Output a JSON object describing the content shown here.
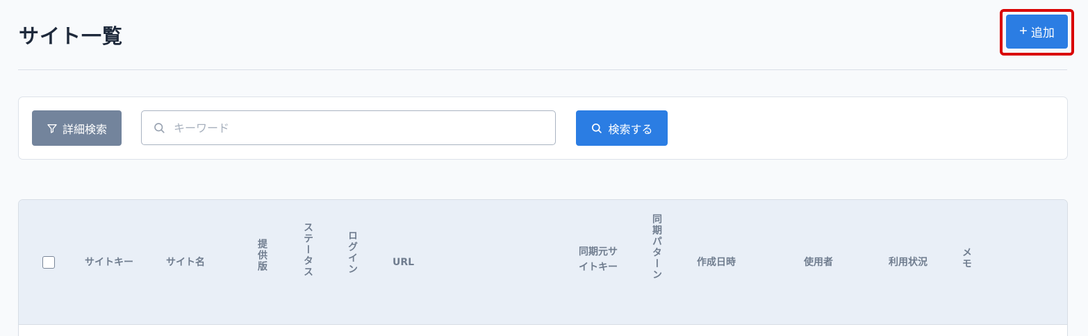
{
  "header": {
    "title": "サイト一覧",
    "add_button_label": "追加",
    "add_button_icon": "plus-icon"
  },
  "search": {
    "detail_button_label": "詳細検索",
    "detail_button_icon": "filter-icon",
    "placeholder": "キーワード",
    "value": "",
    "search_button_label": "検索する",
    "search_button_icon": "search-icon"
  },
  "table": {
    "columns": [
      {
        "key": "site_key",
        "label": "サイトキー"
      },
      {
        "key": "site_name",
        "label": "サイト名"
      },
      {
        "key": "provided_version",
        "label": "提供版"
      },
      {
        "key": "status",
        "label": "ステータス"
      },
      {
        "key": "login",
        "label": "ログイン"
      },
      {
        "key": "url",
        "label": "URL"
      },
      {
        "key": "sync_source_line1",
        "label": "同期元サ"
      },
      {
        "key": "sync_source_line2",
        "label": "イトキー"
      },
      {
        "key": "sync_pattern",
        "label": "同期パターン"
      },
      {
        "key": "created_at",
        "label": "作成日時"
      },
      {
        "key": "user",
        "label": "使用者"
      },
      {
        "key": "usage_status",
        "label": "利用状況"
      },
      {
        "key": "memo",
        "label": "メモ"
      }
    ],
    "rows": []
  },
  "colors": {
    "primary": "#2b7de3",
    "secondary": "#73849c",
    "highlight": "#d90000",
    "header_bg": "#e9eff7"
  }
}
